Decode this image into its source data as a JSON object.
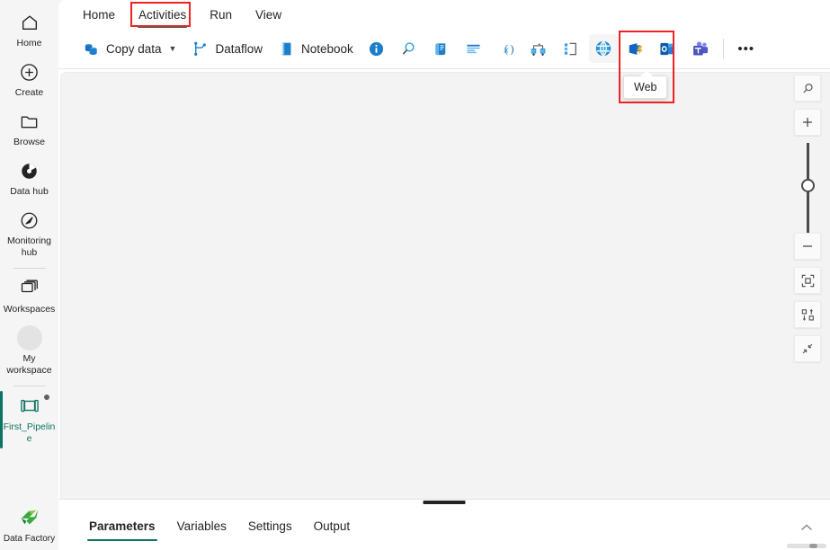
{
  "sidebar": {
    "items": [
      {
        "label": "Home",
        "icon": "home-icon"
      },
      {
        "label": "Create",
        "icon": "plus-circle-icon"
      },
      {
        "label": "Browse",
        "icon": "folder-icon"
      },
      {
        "label": "Data hub",
        "icon": "data-hub-icon"
      },
      {
        "label": "Monitoring hub",
        "icon": "monitoring-hub-icon"
      },
      {
        "label": "Workspaces",
        "icon": "workspaces-icon"
      },
      {
        "label": "My workspace",
        "icon": "avatar-icon"
      },
      {
        "label": "First_Pipeline",
        "icon": "pipeline-icon"
      }
    ],
    "footer": {
      "label": "Data Factory",
      "icon": "data-factory-icon"
    }
  },
  "menubar": {
    "items": [
      {
        "label": "Home",
        "selected": false
      },
      {
        "label": "Activities",
        "selected": true
      },
      {
        "label": "Run",
        "selected": false
      },
      {
        "label": "View",
        "selected": false
      }
    ]
  },
  "toolbar": {
    "copy_data": {
      "label": "Copy data",
      "icon": "copy-data-icon",
      "has_chevron": true
    },
    "dataflow": {
      "label": "Dataflow",
      "icon": "dataflow-icon"
    },
    "notebook": {
      "label": "Notebook",
      "icon": "notebook-icon"
    },
    "icons": [
      {
        "name": "get-metadata-icon",
        "title": "Get metadata"
      },
      {
        "name": "lookup-icon",
        "title": "Lookup"
      },
      {
        "name": "script-icon",
        "title": "Script"
      },
      {
        "name": "delete-data-icon",
        "title": "Delete data"
      },
      {
        "name": "set-variable-icon",
        "title": "Set variable"
      },
      {
        "name": "switch-icon",
        "title": "Switch"
      },
      {
        "name": "if-condition-icon",
        "title": "If condition"
      },
      {
        "name": "web-icon",
        "title": "Web"
      },
      {
        "name": "azure-function-icon",
        "title": "Azure function"
      },
      {
        "name": "outlook-icon",
        "title": "Office 365 Outlook"
      },
      {
        "name": "teams-icon",
        "title": "Teams"
      }
    ],
    "overflow_label": "•••"
  },
  "tooltip": {
    "text": "Web"
  },
  "zoom_tools": [
    {
      "name": "zoom-search-icon"
    },
    {
      "name": "zoom-in-icon"
    },
    {
      "name": "zoom-slider"
    },
    {
      "name": "zoom-out-icon"
    },
    {
      "name": "fit-to-screen-icon"
    },
    {
      "name": "auto-layout-icon"
    },
    {
      "name": "collapse-canvas-icon"
    }
  ],
  "bottom_panel": {
    "tabs": [
      {
        "label": "Parameters",
        "selected": true
      },
      {
        "label": "Variables",
        "selected": false
      },
      {
        "label": "Settings",
        "selected": false
      },
      {
        "label": "Output",
        "selected": false
      }
    ]
  },
  "colors": {
    "accent_teal": "#0f7362",
    "annotation_red": "#ee2222",
    "canvas_gray": "#f3f3f3",
    "sidebar_gray": "#f5f5f5"
  }
}
